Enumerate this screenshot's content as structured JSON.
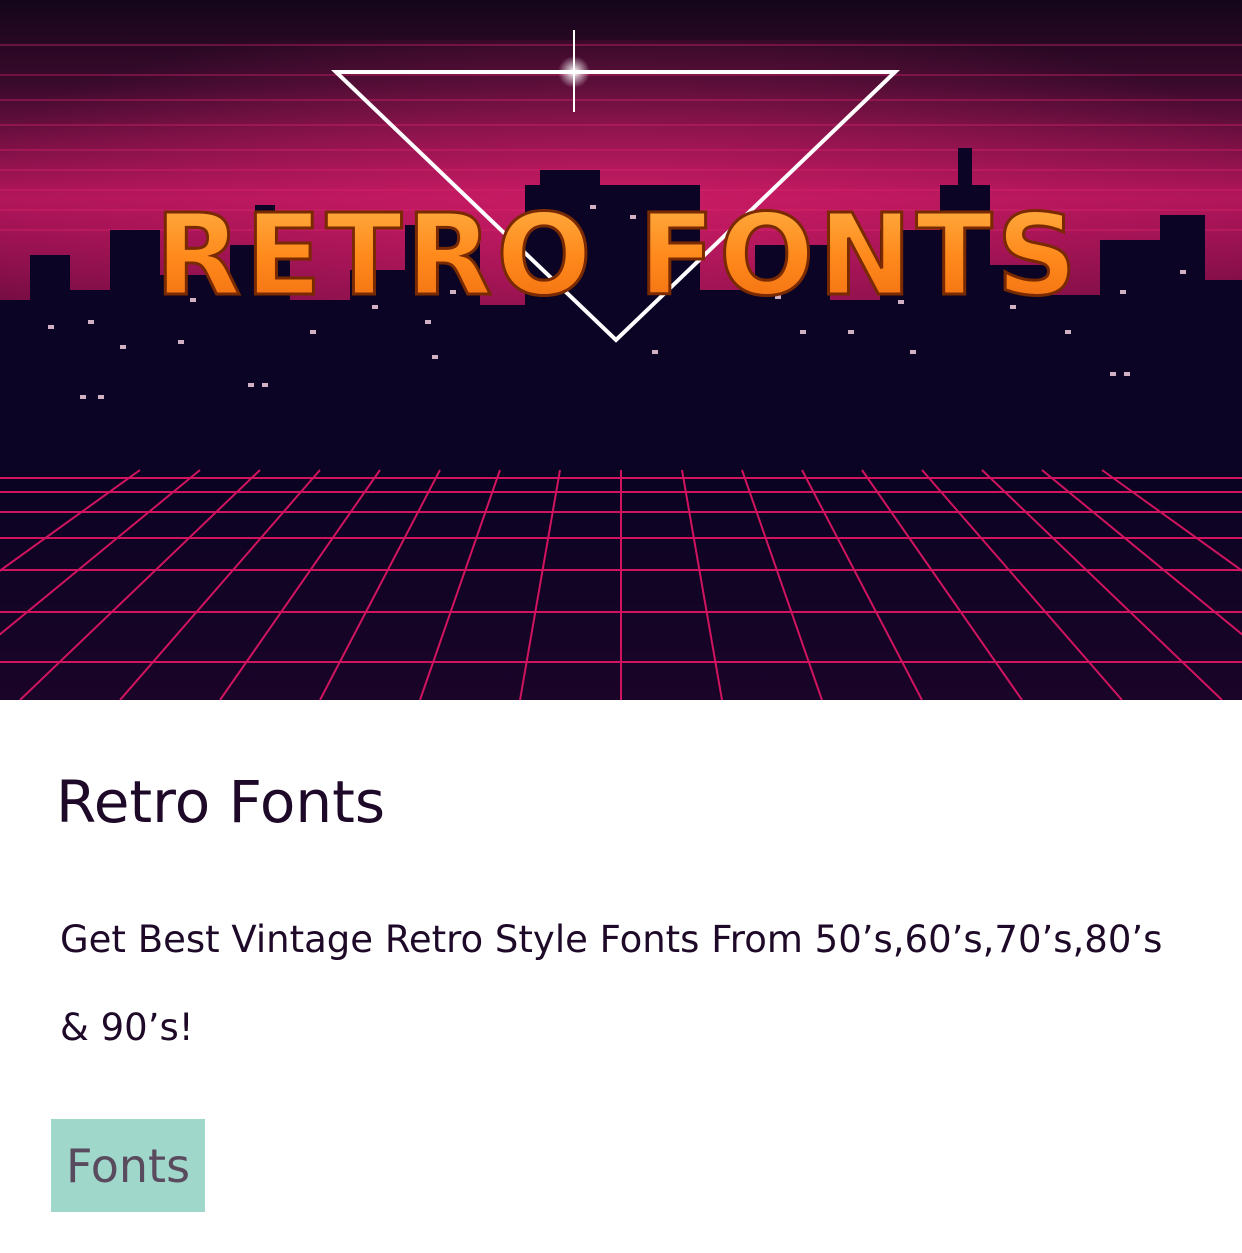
{
  "hero": {
    "title": "RETRO FONTS"
  },
  "card": {
    "title": "Retro Fonts",
    "description": "Get Best Vintage Retro Style Fonts From 50’s,60’s,70’s,80’s & 90’s!",
    "tag": "Fonts"
  },
  "colors": {
    "sky_dark": "#14061a",
    "sky_magenta": "#b0155a",
    "city": "#0b0424",
    "grid_line": "#d0145f",
    "title_orange": "#ff8a1c",
    "tag_background": "#9fd8cb",
    "text": "#1e0a28"
  }
}
